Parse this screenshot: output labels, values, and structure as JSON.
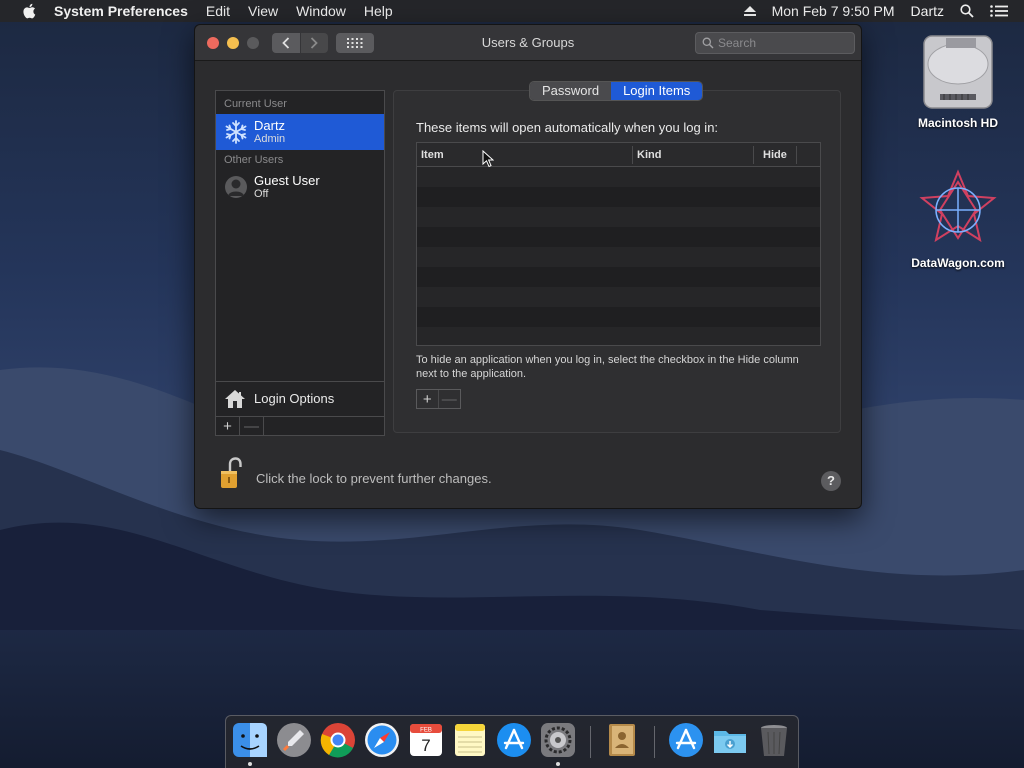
{
  "menubar": {
    "app_name": "System Preferences",
    "items": [
      "Edit",
      "View",
      "Window",
      "Help"
    ],
    "datetime": "Mon Feb 7  9:50 PM",
    "user": "Dartz"
  },
  "window": {
    "title": "Users & Groups",
    "search_placeholder": "Search"
  },
  "sidebar": {
    "current_user_label": "Current User",
    "current_user": {
      "name": "Dartz",
      "role": "Admin"
    },
    "other_users_label": "Other Users",
    "other_users": [
      {
        "name": "Guest User",
        "status": "Off"
      }
    ],
    "login_options_label": "Login Options",
    "add_symbol": "+",
    "remove_symbol": "—"
  },
  "tabs": [
    {
      "label": "Password",
      "active": false
    },
    {
      "label": "Login Items",
      "active": true
    }
  ],
  "login_items": {
    "heading": "These items will open automatically when you log in:",
    "columns": [
      "Item",
      "Kind",
      "Hide"
    ],
    "rows": [],
    "hint": "To hide an application when you log in, select the checkbox in the Hide column next to the application.",
    "add_symbol": "+",
    "remove_symbol": "—"
  },
  "lock": {
    "text": "Click the lock to prevent further changes."
  },
  "help": {
    "symbol": "?"
  },
  "desktop": {
    "icons": [
      {
        "label": "Macintosh HD",
        "icon": "hard-drive-icon"
      },
      {
        "label": "DataWagon.com",
        "icon": "star-logo-icon"
      }
    ]
  },
  "dock": {
    "apps": [
      {
        "name": "Finder",
        "icon": "finder-icon",
        "running": true
      },
      {
        "name": "Launchpad",
        "icon": "launchpad-icon",
        "running": false
      },
      {
        "name": "Chrome",
        "icon": "chrome-icon",
        "running": false
      },
      {
        "name": "Safari",
        "icon": "safari-icon",
        "running": false
      },
      {
        "name": "Calendar",
        "icon": "calendar-icon",
        "running": false
      },
      {
        "name": "Notes",
        "icon": "notes-icon",
        "running": false
      },
      {
        "name": "App Store",
        "icon": "app-store-icon",
        "running": false
      },
      {
        "name": "System Preferences",
        "icon": "system-preferences-icon",
        "running": true
      },
      {
        "name": "Contacts",
        "icon": "contacts-icon",
        "running": false
      },
      {
        "name": "Applications",
        "icon": "applications-folder-icon",
        "running": false
      },
      {
        "name": "Downloads",
        "icon": "downloads-folder-icon",
        "running": false
      },
      {
        "name": "Trash",
        "icon": "trash-icon",
        "running": false
      }
    ],
    "calendar": {
      "month": "FEB",
      "day": "7"
    }
  },
  "colors": {
    "accent": "#1f5ad6",
    "window_bg": "#2c2c2e",
    "close": "#ed6a5e",
    "minimize": "#f5bf4f"
  }
}
